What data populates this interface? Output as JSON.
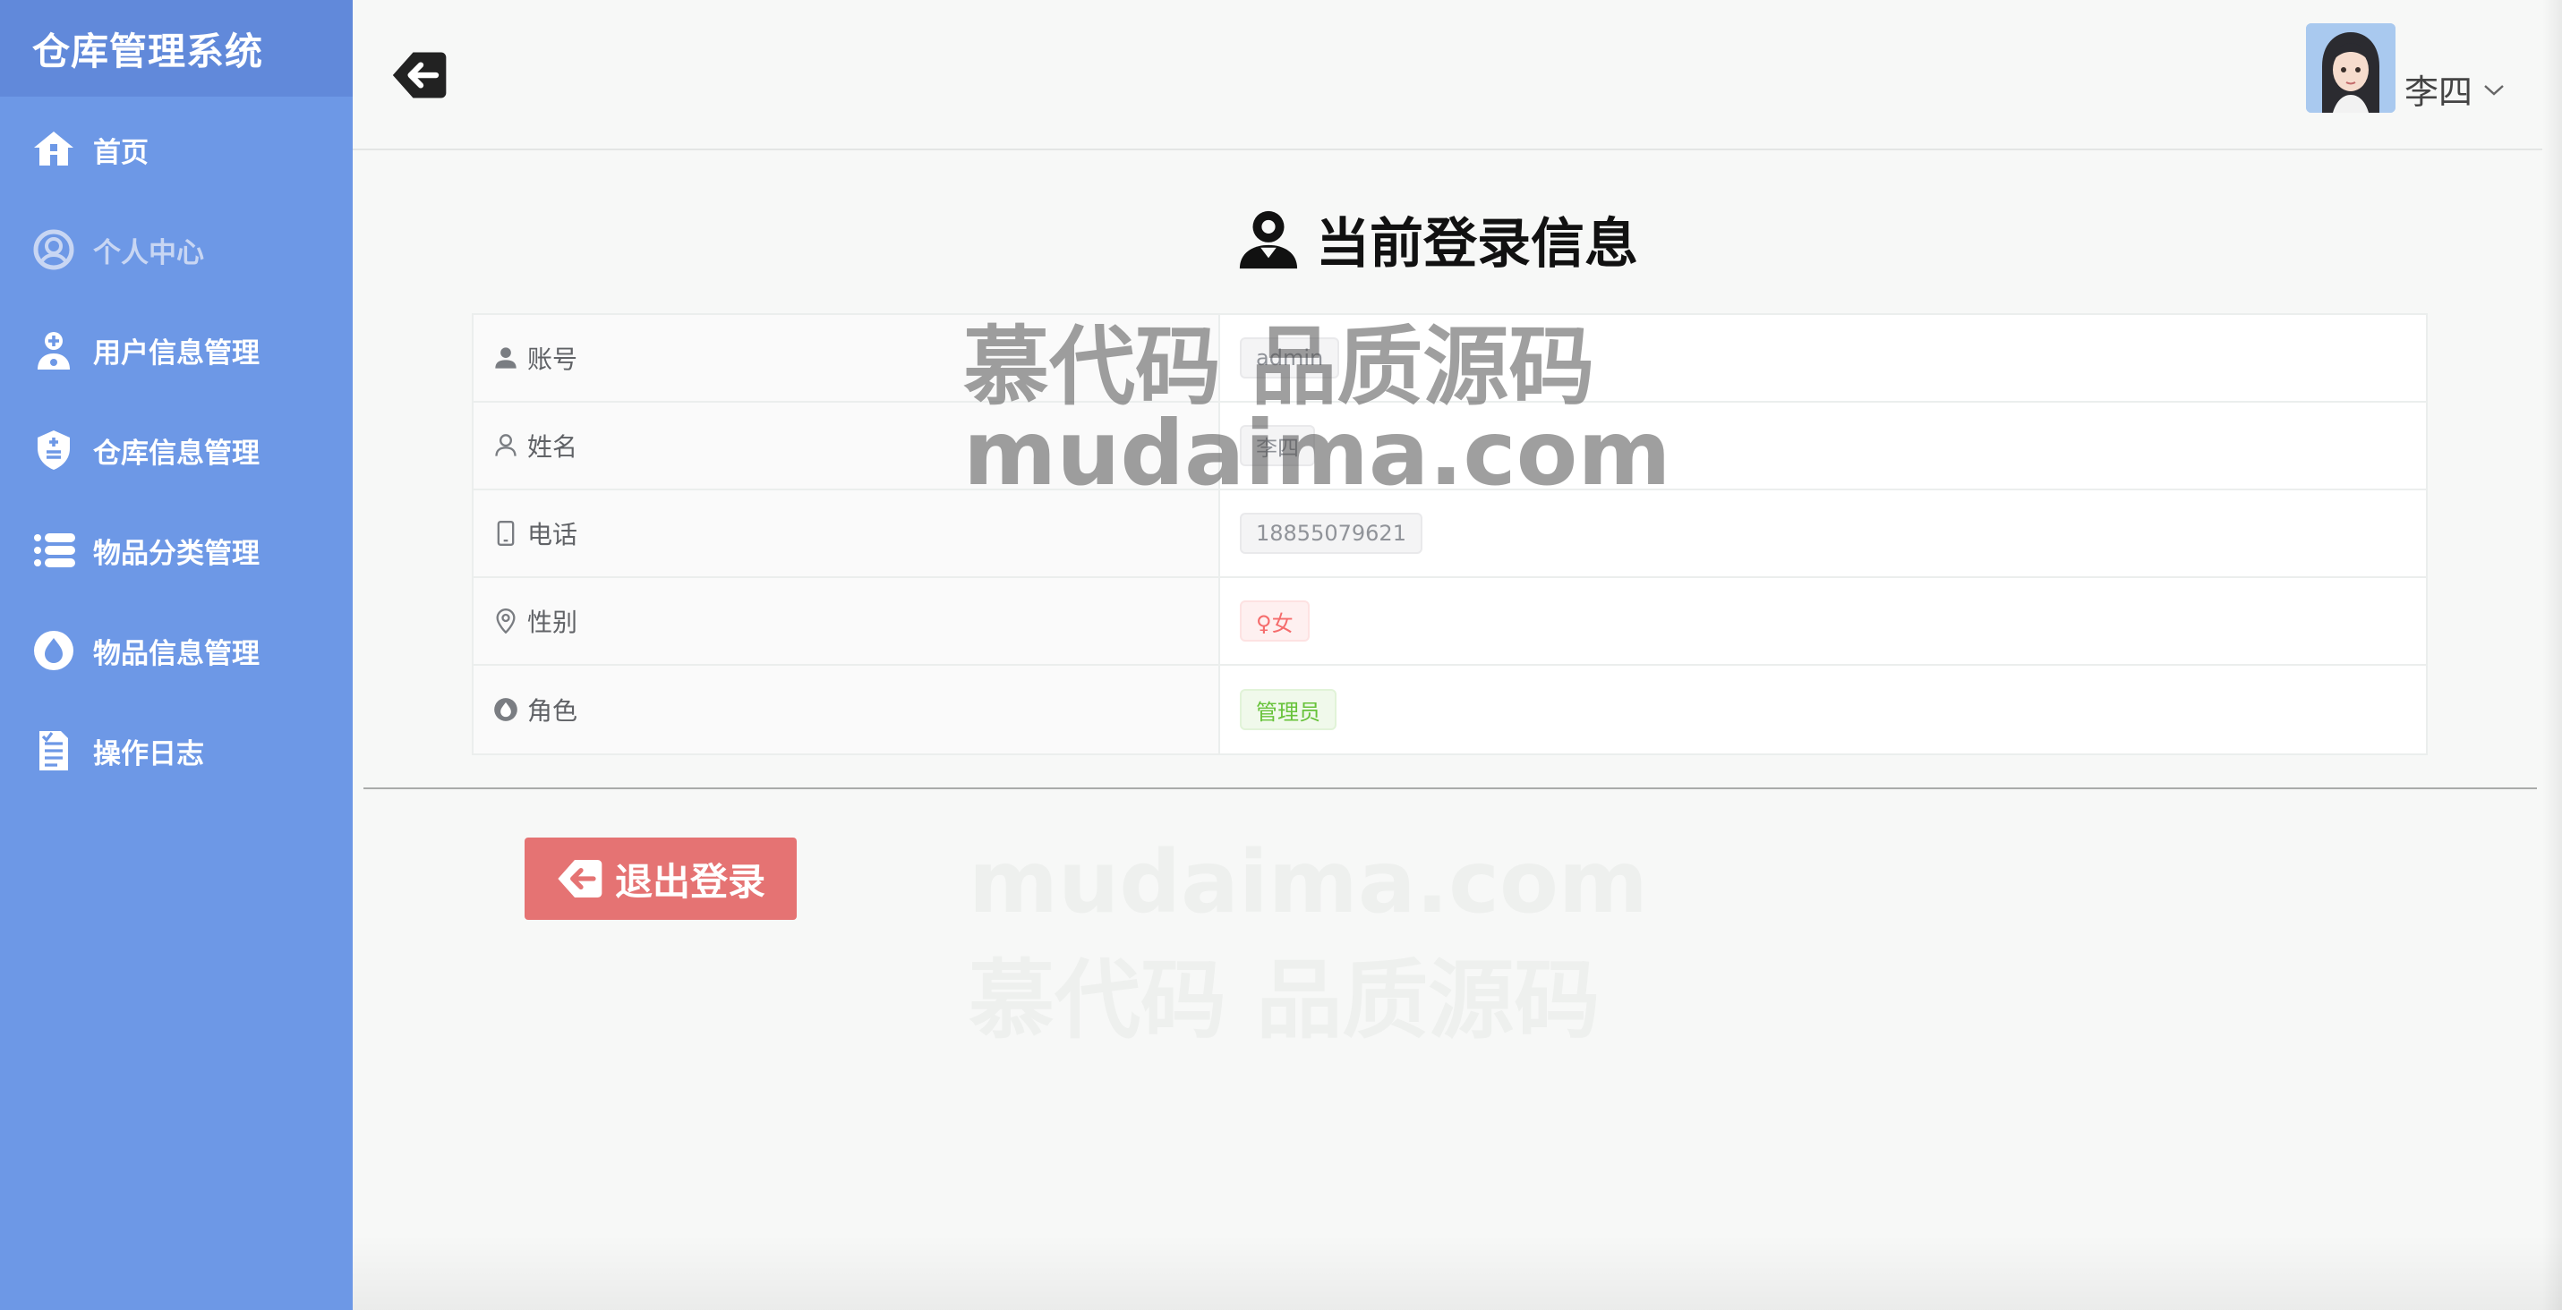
{
  "app": {
    "title": "仓库管理系统"
  },
  "sidebar": {
    "items": [
      {
        "label": "首页",
        "icon": "home-icon"
      },
      {
        "label": "个人中心",
        "icon": "user-heart-icon",
        "active": true
      },
      {
        "label": "用户信息管理",
        "icon": "user-add-icon"
      },
      {
        "label": "仓库信息管理",
        "icon": "shield-icon"
      },
      {
        "label": "物品分类管理",
        "icon": "list-icon"
      },
      {
        "label": "物品信息管理",
        "icon": "drop-icon"
      },
      {
        "label": "操作日志",
        "icon": "document-icon"
      }
    ]
  },
  "header": {
    "user_name": "李四",
    "back_icon": "back-arrow-icon",
    "avatar_icon": "avatar-icon"
  },
  "main": {
    "title": "当前登录信息",
    "rows": [
      {
        "label": "账号",
        "value": "admin",
        "icon": "user-icon"
      },
      {
        "label": "姓名",
        "value": "李四",
        "icon": "user-outline-icon"
      },
      {
        "label": "电话",
        "value": "18855079621",
        "icon": "phone-icon"
      },
      {
        "label": "性别",
        "value": "♀女",
        "icon": "location-icon"
      },
      {
        "label": "角色",
        "value": "管理员",
        "icon": "drop-icon"
      }
    ],
    "logout_label": "退出登录"
  },
  "watermark": {
    "line1": "慕代码 品质源码",
    "line2": "mudaima.com"
  },
  "colors": {
    "sidebar": "#6d98e6",
    "brand_bar": "#6189da",
    "logout": "#e57373"
  }
}
